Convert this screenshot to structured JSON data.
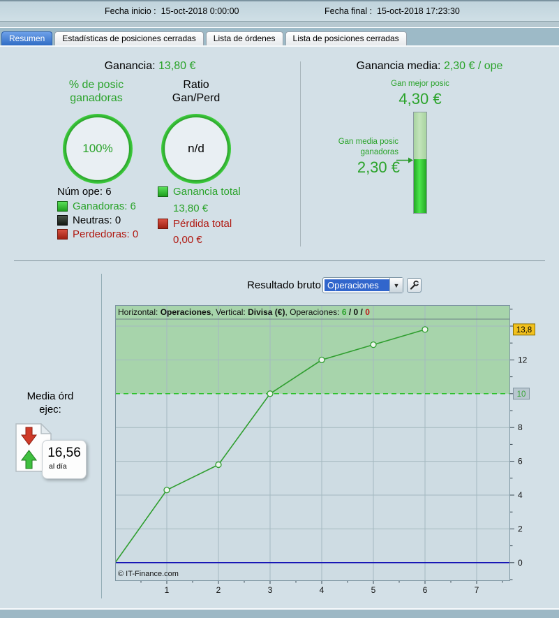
{
  "header": {
    "fecha_inicio_label": "Fecha inicio :  ",
    "fecha_inicio_value": "15-oct-2018 0:00:00",
    "fecha_final_label": "Fecha final :  ",
    "fecha_final_value": "15-oct-2018 17:23:30"
  },
  "tabs": [
    {
      "label": "Resumen",
      "active": true
    },
    {
      "label": "Estadísticas de posiciones cerradas",
      "active": false
    },
    {
      "label": "Lista de órdenes",
      "active": false
    },
    {
      "label": "Lista de posiciones cerradas",
      "active": false
    }
  ],
  "summary": {
    "ganancia_label": "Ganancia: ",
    "ganancia_value": "13,80 €",
    "donut_pct": {
      "title_line1": "% de posic",
      "title_line2": "ganadoras",
      "center": "100%"
    },
    "donut_ratio": {
      "title_line1": "Ratio",
      "title_line2": "Gan/Perd",
      "center": "n/d"
    },
    "num_ope_label": "Núm ope: ",
    "num_ope_value": "6",
    "legend": [
      {
        "label": "Ganadoras: 6",
        "color": "green"
      },
      {
        "label": "Neutras: 0",
        "color": "black"
      },
      {
        "label": "Perdedoras: 0",
        "color": "red"
      }
    ],
    "totals": [
      {
        "label": "Ganancia total",
        "value": "13,80 €",
        "color": "green"
      },
      {
        "label": "Pérdida total",
        "value": "0,00 €",
        "color": "red"
      }
    ]
  },
  "media": {
    "title_label": "Ganancia media: ",
    "title_value": "2,30 € / ope",
    "best_label": "Gan mejor posic",
    "best_value": "4,30 €",
    "avg_label_line1": "Gan media posic",
    "avg_label_line2": "ganadoras",
    "avg_value": "2,30 €",
    "bar": {
      "max": 4.3,
      "avg": 2.3
    }
  },
  "resultado": {
    "label": "Resultado bruto",
    "dropdown_value": "Operaciones"
  },
  "media_ord": {
    "label_line1": "Media órd",
    "label_line2": "ejec:",
    "value": "16,56",
    "unit": "al día"
  },
  "chart_data": {
    "type": "line",
    "x": [
      0,
      1,
      2,
      3,
      4,
      5,
      6
    ],
    "y": [
      0,
      4.3,
      5.8,
      10,
      12,
      12.9,
      13.8
    ],
    "x_ticks": [
      1,
      2,
      3,
      4,
      5,
      6,
      7
    ],
    "y_ticks": [
      0,
      2,
      4,
      6,
      8,
      12
    ],
    "y_tick_marks": [
      0,
      2,
      4,
      6,
      8,
      10,
      12,
      14
    ],
    "y_minor": [
      -1,
      1,
      3,
      5,
      7,
      9,
      11,
      13,
      15
    ],
    "grid_y": [
      2,
      4,
      6,
      8,
      12,
      14
    ],
    "xlim": [
      0,
      7.65
    ],
    "ylim": [
      -1.08,
      15.24
    ],
    "threshold": 10,
    "threshold_label": "10",
    "last_label": "13,8",
    "zero_line": 0,
    "watermark": "© IT-Finance.com",
    "info_segments": [
      {
        "t": "Horizontal: "
      },
      {
        "t": "Operaciones",
        "b": 1
      },
      {
        "t": ", Vertical: "
      },
      {
        "t": "Divisa (€)",
        "b": 1
      },
      {
        "t": ", Operaciones: "
      },
      {
        "t": "6",
        "b": 1,
        "c": "#2aa32a"
      },
      {
        "t": " / ",
        "b": 1
      },
      {
        "t": "0",
        "b": 1
      },
      {
        "t": " / ",
        "b": 1
      },
      {
        "t": "0",
        "b": 1,
        "c": "#c01818"
      }
    ],
    "colors": {
      "plot_bg": "#cedce3",
      "band": "#a7d4ab",
      "grid": "#a4b9c0",
      "line": "#2f9e2f",
      "marker_fill": "#eef5ee",
      "threshold_color": "#2ec22e",
      "threshold_text": "#3aa63a",
      "zero_color": "#1515b5",
      "border": "#7e96a2",
      "tick": "#3a4a55",
      "info_border": "#6e8087",
      "thr_box_bg": "#b9c7d0",
      "thr_box_border": "#8296a1",
      "last_box_bg": "#f2c11e",
      "last_box_border": "#8a7000"
    }
  }
}
